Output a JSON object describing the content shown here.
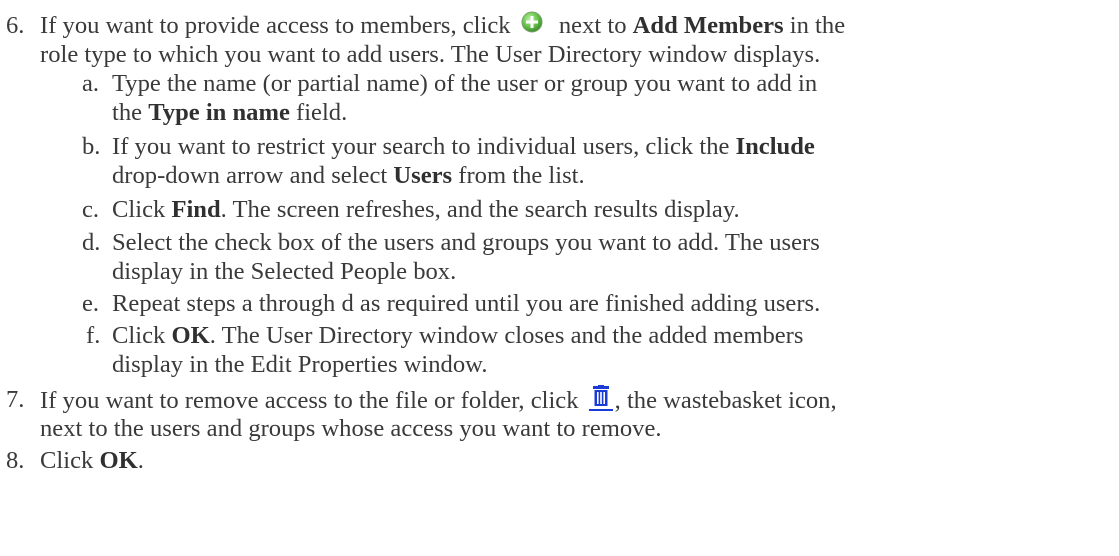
{
  "steps": [
    {
      "number": "6.",
      "line1_a": "If you want to provide access to members, click",
      "line1_icon": "add-circle-icon",
      "line1_b": "next to",
      "line1_bold": "Add Members",
      "line1_c": "in the",
      "line2": "role type to which you want to add users. The User Directory window displays.",
      "substeps": [
        {
          "letter": "a.",
          "a": "Type the name (or partial name) of the user or group you want to add in",
          "b": "the",
          "bold": "Type in name",
          "c": "field."
        },
        {
          "letter": "b.",
          "a": "If you want to restrict your search to individual users, click the",
          "bold1": "Include",
          "b": "drop-down arrow and select",
          "bold2": "Users",
          "c": "from the list."
        },
        {
          "letter": "c.",
          "a": "Click",
          "bold": "Find",
          "b": ". The screen refreshes, and the search results display."
        },
        {
          "letter": "d.",
          "a": "Select the check box of the users and groups you want to add. The users",
          "b": "display in the Selected People box."
        },
        {
          "letter": "e.",
          "a": "Repeat steps a through d as required until you are finished adding users."
        },
        {
          "letter": "f.",
          "a": "Click",
          "bold": "OK",
          "b": ". The User Directory window closes and the added members",
          "c": "display in the Edit Properties window."
        }
      ]
    },
    {
      "number": "7.",
      "a": "If you want to remove access to the file or folder, click",
      "icon": "wastebasket-icon",
      "b": ", the wastebasket icon,",
      "c": "next to the users and groups whose access you want to remove."
    },
    {
      "number": "8.",
      "a": "Click",
      "bold": "OK",
      "b": "."
    }
  ],
  "colors": {
    "text": "#3a3a3a",
    "plus_icon": "#4caf3a",
    "trash_icon": "#1a3bd6"
  }
}
